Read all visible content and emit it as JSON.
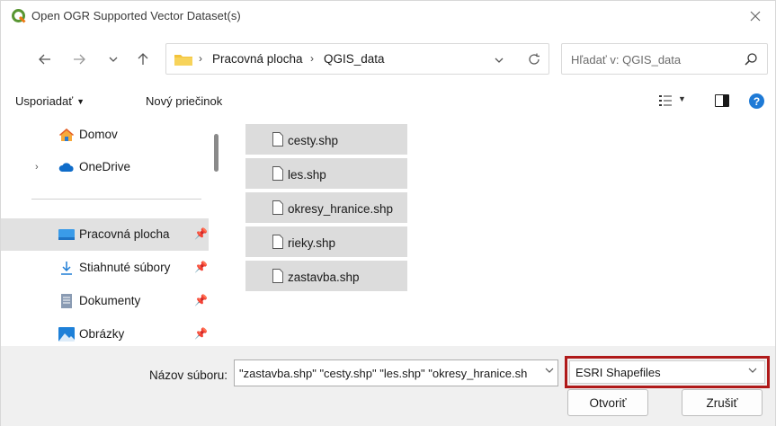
{
  "window": {
    "title": "Open OGR Supported Vector Dataset(s)"
  },
  "nav": {
    "breadcrumb": [
      "Pracovná plocha",
      "QGIS_data"
    ],
    "search_placeholder": "Hľadať v: QGIS_data"
  },
  "toolbar": {
    "organize_label": "Usporiadať",
    "new_folder_label": "Nový priečinok"
  },
  "sidebar": {
    "items": [
      {
        "label": "Domov",
        "icon": "home-icon"
      },
      {
        "label": "OneDrive",
        "icon": "cloud-icon"
      },
      {
        "label": "Pracovná plocha",
        "icon": "desktop-icon",
        "selected": true
      },
      {
        "label": "Stiahnuté súbory",
        "icon": "download-icon"
      },
      {
        "label": "Dokumenty",
        "icon": "document-icon"
      },
      {
        "label": "Obrázky",
        "icon": "pictures-icon"
      }
    ]
  },
  "files": [
    {
      "name": "cesty.shp"
    },
    {
      "name": "les.shp"
    },
    {
      "name": "okresy_hranice.shp"
    },
    {
      "name": "rieky.shp"
    },
    {
      "name": "zastavba.shp"
    }
  ],
  "bottom": {
    "filename_label": "Názov súboru:",
    "filename_value": "\"zastavba.shp\" \"cesty.shp\" \"les.shp\" \"okresy_hranice.sh",
    "filter_value": "ESRI Shapefiles",
    "open_label": "Otvoriť",
    "cancel_label": "Zrušiť"
  },
  "colors": {
    "accent": "#1e7ad6",
    "highlight_border": "#b01a1a",
    "qgis_green": "#589632"
  }
}
